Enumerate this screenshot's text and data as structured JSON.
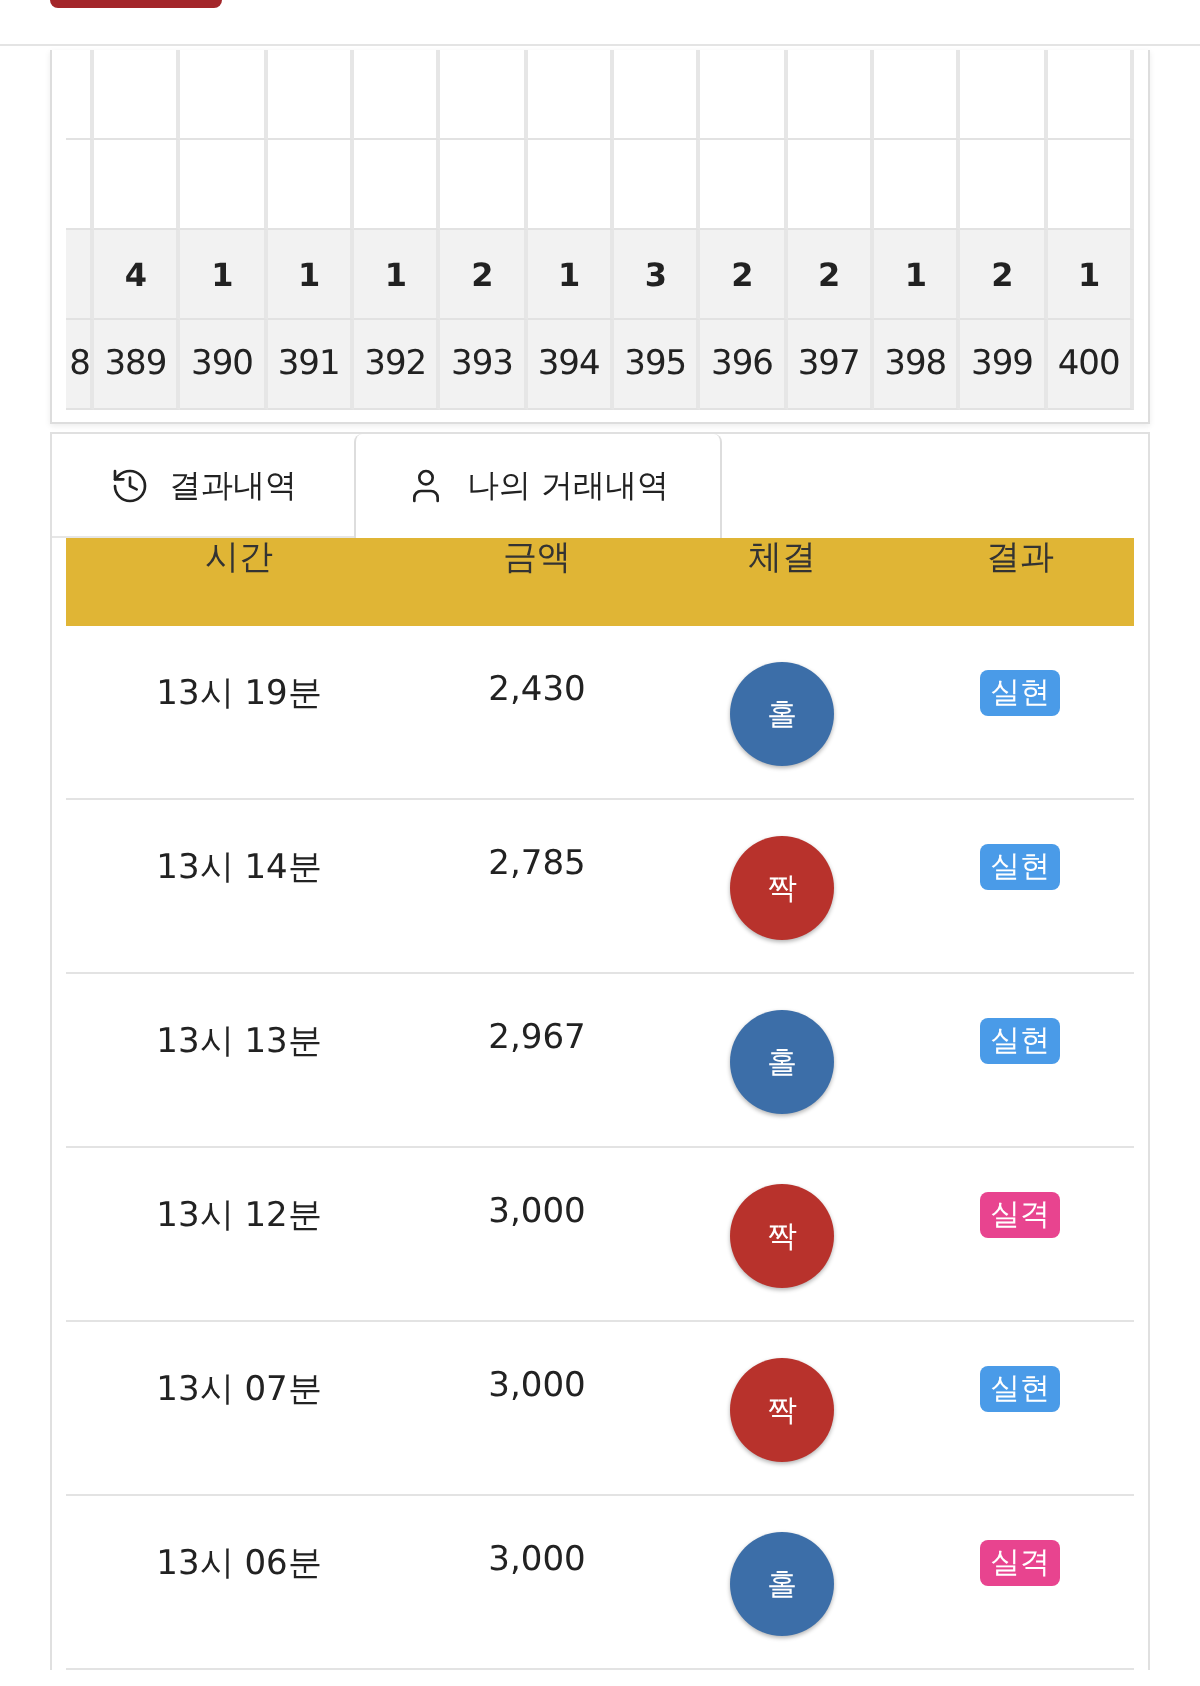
{
  "grid": {
    "columns": [
      {
        "number": "8"
      },
      {
        "count": "4",
        "number": "389"
      },
      {
        "count": "1",
        "number": "390"
      },
      {
        "count": "1",
        "number": "391"
      },
      {
        "count": "1",
        "number": "392"
      },
      {
        "count": "2",
        "number": "393"
      },
      {
        "count": "1",
        "number": "394"
      },
      {
        "count": "3",
        "number": "395"
      },
      {
        "count": "2",
        "number": "396"
      },
      {
        "count": "2",
        "number": "397"
      },
      {
        "count": "1",
        "number": "398"
      },
      {
        "count": "2",
        "number": "399"
      },
      {
        "count": "1",
        "number": "400"
      }
    ]
  },
  "tabs": [
    {
      "label": "결과내역",
      "selected": false
    },
    {
      "label": "나의 거래내역",
      "selected": true
    }
  ],
  "table": {
    "columns": [
      "시간",
      "금액",
      "체결",
      "결과"
    ],
    "rows": [
      {
        "time": "13시 19분",
        "amount": "2,430",
        "bet": {
          "label": "홀",
          "kind": "odd"
        },
        "result": {
          "label": "실현",
          "kind": "hit"
        }
      },
      {
        "time": "13시 14분",
        "amount": "2,785",
        "bet": {
          "label": "짝",
          "kind": "even"
        },
        "result": {
          "label": "실현",
          "kind": "hit"
        }
      },
      {
        "time": "13시 13분",
        "amount": "2,967",
        "bet": {
          "label": "홀",
          "kind": "odd"
        },
        "result": {
          "label": "실현",
          "kind": "hit"
        }
      },
      {
        "time": "13시 12분",
        "amount": "3,000",
        "bet": {
          "label": "짝",
          "kind": "even"
        },
        "result": {
          "label": "실격",
          "kind": "miss"
        }
      },
      {
        "time": "13시 07분",
        "amount": "3,000",
        "bet": {
          "label": "짝",
          "kind": "even"
        },
        "result": {
          "label": "실현",
          "kind": "hit"
        }
      },
      {
        "time": "13시 06분",
        "amount": "3,000",
        "bet": {
          "label": "홀",
          "kind": "odd"
        },
        "result": {
          "label": "실격",
          "kind": "miss"
        }
      }
    ]
  }
}
